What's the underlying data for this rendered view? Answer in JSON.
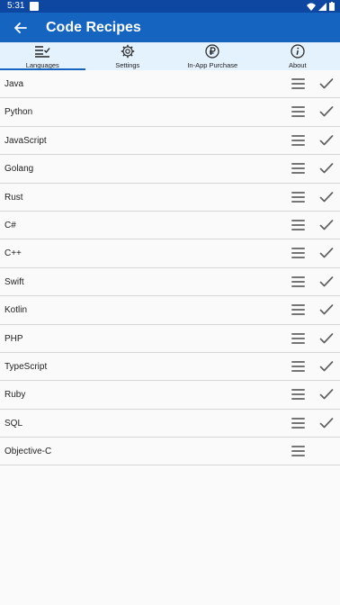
{
  "status_bar": {
    "time": "5:31"
  },
  "app_bar": {
    "title": "Code Recipes"
  },
  "tabs": [
    {
      "label": "Languages",
      "icon": "list-check-icon",
      "active": true
    },
    {
      "label": "Settings",
      "icon": "gear-icon",
      "active": false
    },
    {
      "label": "In-App Purchase",
      "icon": "ruble-coin-icon",
      "active": false
    },
    {
      "label": "About",
      "icon": "info-icon",
      "active": false
    }
  ],
  "languages": [
    {
      "name": "Java",
      "checked": true
    },
    {
      "name": "Python",
      "checked": true
    },
    {
      "name": "JavaScript",
      "checked": true
    },
    {
      "name": "Golang",
      "checked": true
    },
    {
      "name": "Rust",
      "checked": true
    },
    {
      "name": "C#",
      "checked": true
    },
    {
      "name": "C++",
      "checked": true
    },
    {
      "name": "Swift",
      "checked": true
    },
    {
      "name": "Kotlin",
      "checked": true
    },
    {
      "name": "PHP",
      "checked": true
    },
    {
      "name": "TypeScript",
      "checked": true
    },
    {
      "name": "Ruby",
      "checked": true
    },
    {
      "name": "SQL",
      "checked": true
    },
    {
      "name": "Objective-C",
      "checked": false
    }
  ],
  "colors": {
    "status_bar": "#0d47a1",
    "app_bar": "#1565c0",
    "tab_bar": "#e3f2fd",
    "handle": "#757575"
  }
}
